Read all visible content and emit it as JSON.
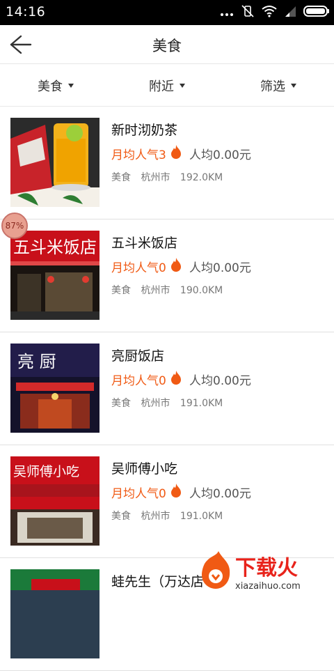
{
  "status_bar": {
    "time": "14:16"
  },
  "header": {
    "title": "美食"
  },
  "filters": [
    {
      "label": "美食"
    },
    {
      "label": "附近"
    },
    {
      "label": "筛选"
    }
  ],
  "items": [
    {
      "name": "新时沏奶茶",
      "popularity": "月均人气3",
      "avg_price": "人均0.00元",
      "category": "美食",
      "city": "杭州市",
      "distance": "192.0KM"
    },
    {
      "name": "五斗米饭店",
      "popularity": "月均人气0",
      "avg_price": "人均0.00元",
      "category": "美食",
      "city": "杭州市",
      "distance": "190.0KM",
      "sign": "五斗米饭店"
    },
    {
      "name": "亮厨饭店",
      "popularity": "月均人气0",
      "avg_price": "人均0.00元",
      "category": "美食",
      "city": "杭州市",
      "distance": "191.0KM",
      "sign": "亮 厨"
    },
    {
      "name": "吴师傅小吃",
      "popularity": "月均人气0",
      "avg_price": "人均0.00元",
      "category": "美食",
      "city": "杭州市",
      "distance": "191.0KM",
      "sign": "吴师傅小吃"
    },
    {
      "name": "蛙先生（万达店",
      "popularity": "",
      "avg_price": "",
      "category": "",
      "city": "",
      "distance": ""
    }
  ],
  "overlay_badge": "87%",
  "watermark": {
    "text": "下载火",
    "url": "xiazaihuo.com"
  },
  "colors": {
    "accent": "#f05a14",
    "statusbar": "#000000"
  }
}
